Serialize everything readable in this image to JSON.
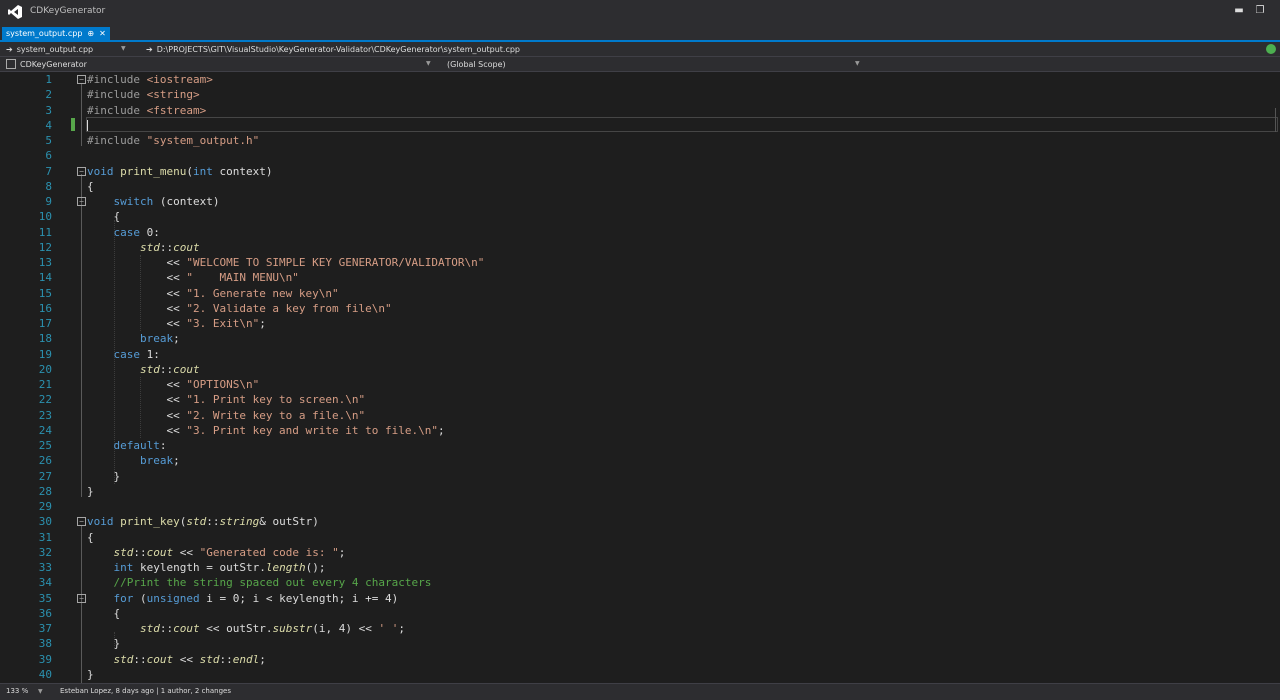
{
  "window": {
    "title": "CDKeyGenerator",
    "min_glyph": "▬",
    "restore_glyph": "❐"
  },
  "tab": {
    "label": "system_output.cpp",
    "pin_glyph": "⊕",
    "close_glyph": "✕"
  },
  "navbar": {
    "file_dropdown": "system_output.cpp",
    "path": "D:\\PROJECTS\\GIT\\VisualStudio\\KeyGenerator-Validator\\CDKeyGenerator\\system_output.cpp",
    "project_dropdown": "CDKeyGenerator",
    "scope_dropdown": "(Global Scope)"
  },
  "editor": {
    "line_numbers": [
      "1",
      "2",
      "3",
      "4",
      "5",
      "6",
      "7",
      "8",
      "9",
      "10",
      "11",
      "12",
      "13",
      "14",
      "15",
      "16",
      "17",
      "18",
      "19",
      "20",
      "21",
      "22",
      "23",
      "24",
      "25",
      "26",
      "27",
      "28",
      "29",
      "30",
      "31",
      "32",
      "33",
      "34",
      "35",
      "36",
      "37",
      "38",
      "39",
      "40"
    ],
    "lines": [
      [
        {
          "t": "#include ",
          "c": "pp"
        },
        {
          "t": "<iostream>",
          "c": "ang"
        }
      ],
      [
        {
          "t": "#include ",
          "c": "pp"
        },
        {
          "t": "<string>",
          "c": "ang"
        }
      ],
      [
        {
          "t": "#include ",
          "c": "pp"
        },
        {
          "t": "<fstream>",
          "c": "ang"
        }
      ],
      [],
      [
        {
          "t": "#include ",
          "c": "pp"
        },
        {
          "t": "\"system_output.h\"",
          "c": "str"
        }
      ],
      [],
      [
        {
          "t": "void",
          "c": "kw"
        },
        {
          "t": " "
        },
        {
          "t": "print_menu",
          "c": "fn"
        },
        {
          "t": "("
        },
        {
          "t": "int",
          "c": "kw"
        },
        {
          "t": " context)"
        }
      ],
      [
        {
          "t": "{"
        }
      ],
      [
        {
          "t": "    "
        },
        {
          "t": "switch",
          "c": "kw"
        },
        {
          "t": " (context)"
        }
      ],
      [
        {
          "t": "    {"
        }
      ],
      [
        {
          "t": "    "
        },
        {
          "t": "case",
          "c": "kw"
        },
        {
          "t": " 0:"
        }
      ],
      [
        {
          "t": "        "
        },
        {
          "t": "std",
          "c": "ns"
        },
        {
          "t": "::"
        },
        {
          "t": "cout",
          "c": "ns"
        }
      ],
      [
        {
          "t": "            << "
        },
        {
          "t": "\"WELCOME TO SIMPLE KEY GENERATOR/VALIDATOR\\n\"",
          "c": "str"
        }
      ],
      [
        {
          "t": "            << "
        },
        {
          "t": "\"    MAIN MENU\\n\"",
          "c": "str"
        }
      ],
      [
        {
          "t": "            << "
        },
        {
          "t": "\"1. Generate new key\\n\"",
          "c": "str"
        }
      ],
      [
        {
          "t": "            << "
        },
        {
          "t": "\"2. Validate a key from file\\n\"",
          "c": "str"
        }
      ],
      [
        {
          "t": "            << "
        },
        {
          "t": "\"3. Exit\\n\"",
          "c": "str"
        },
        {
          "t": ";"
        }
      ],
      [
        {
          "t": "        "
        },
        {
          "t": "break",
          "c": "kw"
        },
        {
          "t": ";"
        }
      ],
      [
        {
          "t": "    "
        },
        {
          "t": "case",
          "c": "kw"
        },
        {
          "t": " 1:"
        }
      ],
      [
        {
          "t": "        "
        },
        {
          "t": "std",
          "c": "ns"
        },
        {
          "t": "::"
        },
        {
          "t": "cout",
          "c": "ns"
        }
      ],
      [
        {
          "t": "            << "
        },
        {
          "t": "\"OPTIONS\\n\"",
          "c": "str"
        }
      ],
      [
        {
          "t": "            << "
        },
        {
          "t": "\"1. Print key to screen.\\n\"",
          "c": "str"
        }
      ],
      [
        {
          "t": "            << "
        },
        {
          "t": "\"2. Write key to a file.\\n\"",
          "c": "str"
        }
      ],
      [
        {
          "t": "            << "
        },
        {
          "t": "\"3. Print key and write it to file.\\n\"",
          "c": "str"
        },
        {
          "t": ";"
        }
      ],
      [
        {
          "t": "    "
        },
        {
          "t": "default",
          "c": "kw"
        },
        {
          "t": ":"
        }
      ],
      [
        {
          "t": "        "
        },
        {
          "t": "break",
          "c": "kw"
        },
        {
          "t": ";"
        }
      ],
      [
        {
          "t": "    }"
        }
      ],
      [
        {
          "t": "}"
        }
      ],
      [],
      [
        {
          "t": "void",
          "c": "kw"
        },
        {
          "t": " "
        },
        {
          "t": "print_key",
          "c": "fn"
        },
        {
          "t": "("
        },
        {
          "t": "std",
          "c": "ns"
        },
        {
          "t": "::"
        },
        {
          "t": "string",
          "c": "ns"
        },
        {
          "t": "& outStr)"
        }
      ],
      [
        {
          "t": "{"
        }
      ],
      [
        {
          "t": "    "
        },
        {
          "t": "std",
          "c": "ns"
        },
        {
          "t": "::"
        },
        {
          "t": "cout",
          "c": "ns"
        },
        {
          "t": " << "
        },
        {
          "t": "\"Generated code is: \"",
          "c": "str"
        },
        {
          "t": ";"
        }
      ],
      [
        {
          "t": "    "
        },
        {
          "t": "int",
          "c": "kw"
        },
        {
          "t": " keylength = outStr."
        },
        {
          "t": "length",
          "c": "mem"
        },
        {
          "t": "();"
        }
      ],
      [
        {
          "t": "    "
        },
        {
          "t": "//Print the string spaced out every 4 characters",
          "c": "cm"
        }
      ],
      [
        {
          "t": "    "
        },
        {
          "t": "for",
          "c": "kw"
        },
        {
          "t": " ("
        },
        {
          "t": "unsigned",
          "c": "kw"
        },
        {
          "t": " i = 0; i < keylength; i += 4)"
        }
      ],
      [
        {
          "t": "    {"
        }
      ],
      [
        {
          "t": "        "
        },
        {
          "t": "std",
          "c": "ns"
        },
        {
          "t": "::"
        },
        {
          "t": "cout",
          "c": "ns"
        },
        {
          "t": " << outStr."
        },
        {
          "t": "substr",
          "c": "mem"
        },
        {
          "t": "(i, 4) << "
        },
        {
          "t": "' '",
          "c": "str"
        },
        {
          "t": ";"
        }
      ],
      [
        {
          "t": "    }"
        }
      ],
      [
        {
          "t": "    "
        },
        {
          "t": "std",
          "c": "ns"
        },
        {
          "t": "::"
        },
        {
          "t": "cout",
          "c": "ns"
        },
        {
          "t": " << "
        },
        {
          "t": "std",
          "c": "ns"
        },
        {
          "t": "::"
        },
        {
          "t": "endl",
          "c": "ns"
        },
        {
          "t": ";"
        }
      ],
      [
        {
          "t": "}"
        }
      ]
    ],
    "fold_lines": [
      1,
      7,
      9,
      30,
      35
    ]
  },
  "statusbar": {
    "zoom": "133 %",
    "git_info": "Esteban Lopez, 8 days ago | 1 author, 2 changes"
  }
}
